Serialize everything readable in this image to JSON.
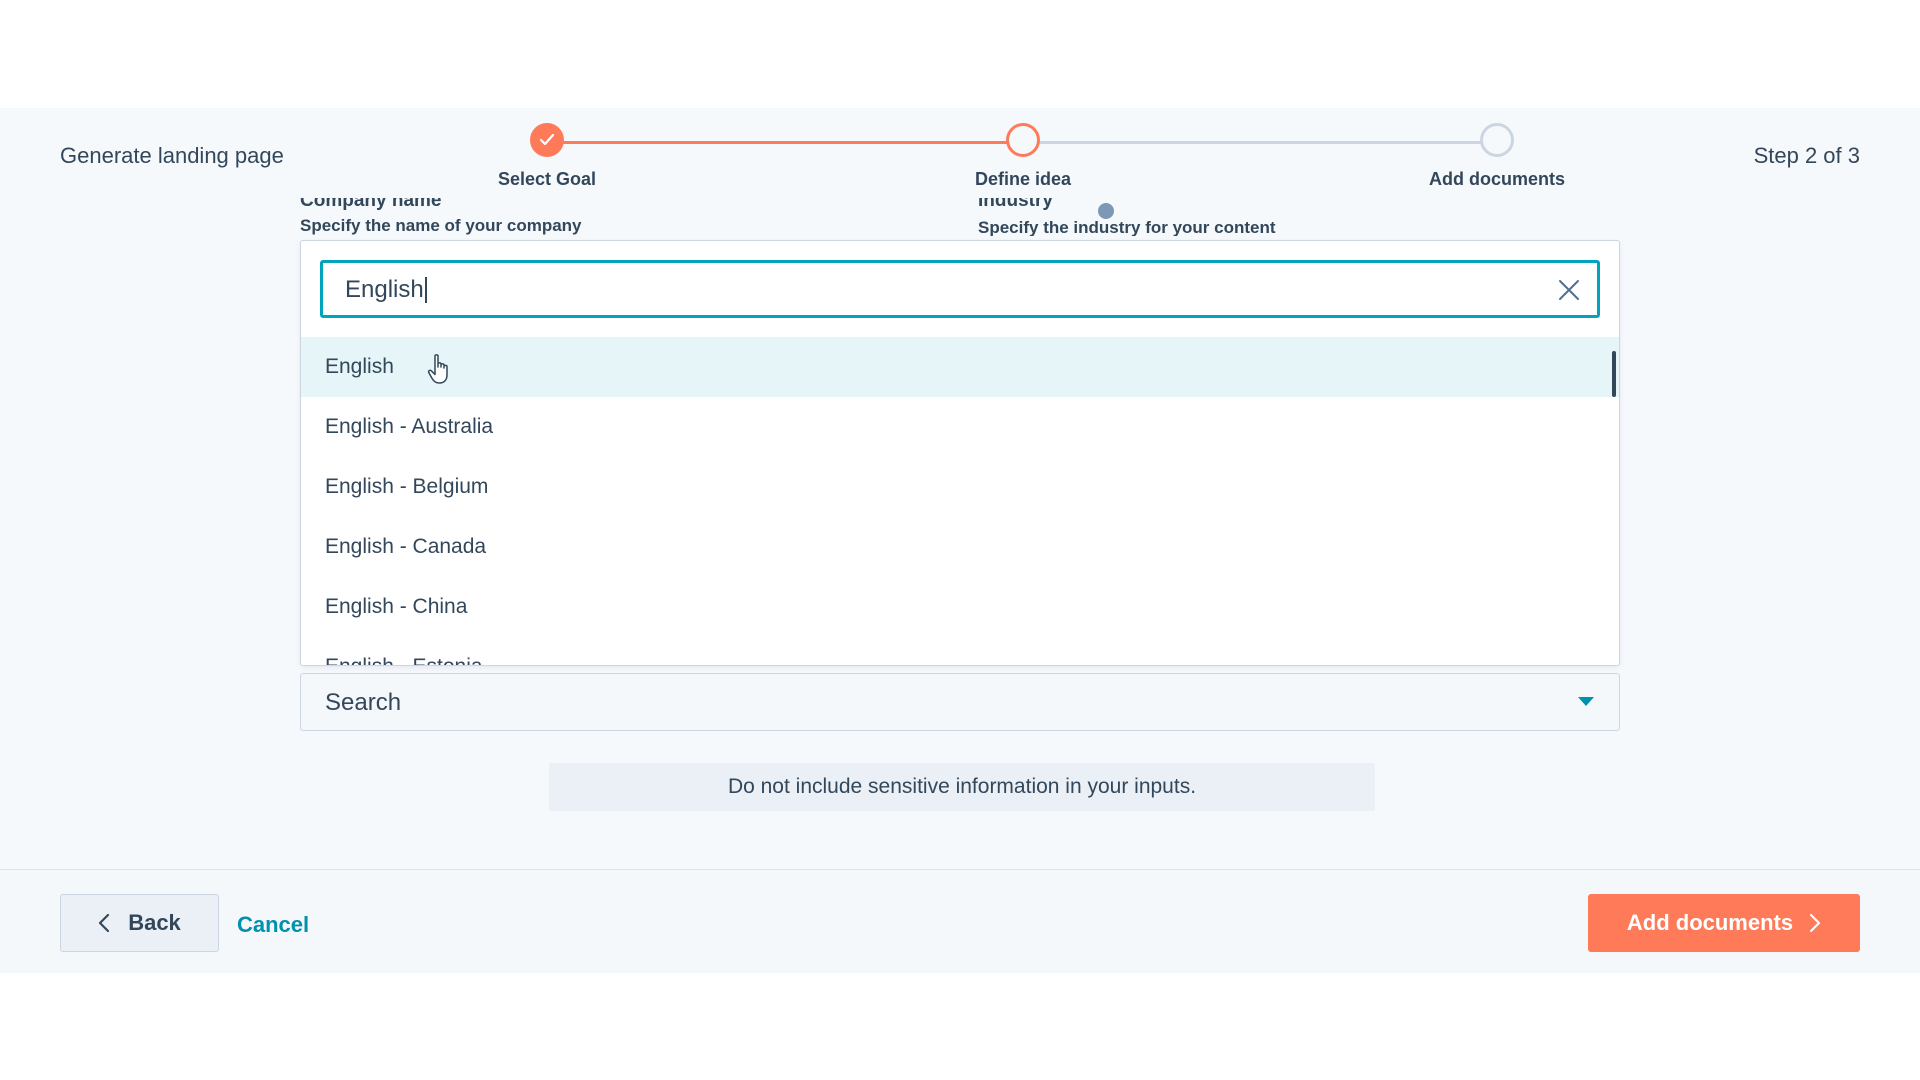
{
  "header": {
    "title": "Generate landing page",
    "step_count": "Step 2 of 3"
  },
  "stepper": {
    "steps": [
      {
        "label": "Select Goal",
        "status": "done"
      },
      {
        "label": "Define idea",
        "status": "active"
      },
      {
        "label": "Add documents",
        "status": "todo"
      }
    ]
  },
  "form": {
    "company_label": "Company name",
    "company_help": "Specify the name of your company",
    "industry_label": "Industry",
    "industry_help": "Specify the industry for your content"
  },
  "language_dropdown": {
    "search_value": "English",
    "options": [
      "English",
      "English - Australia",
      "English - Belgium",
      "English - Canada",
      "English - China",
      "English - Estonia"
    ],
    "hovered_index": 0
  },
  "search_select": {
    "placeholder": "Search"
  },
  "notice": "Do not include sensitive information in your inputs.",
  "footer": {
    "back_label": "Back",
    "cancel_label": "Cancel",
    "next_label": "Add documents"
  },
  "colors": {
    "accent": "#ff7a59",
    "focus": "#00a4bd",
    "link": "#0091ae",
    "text": "#33475b"
  }
}
